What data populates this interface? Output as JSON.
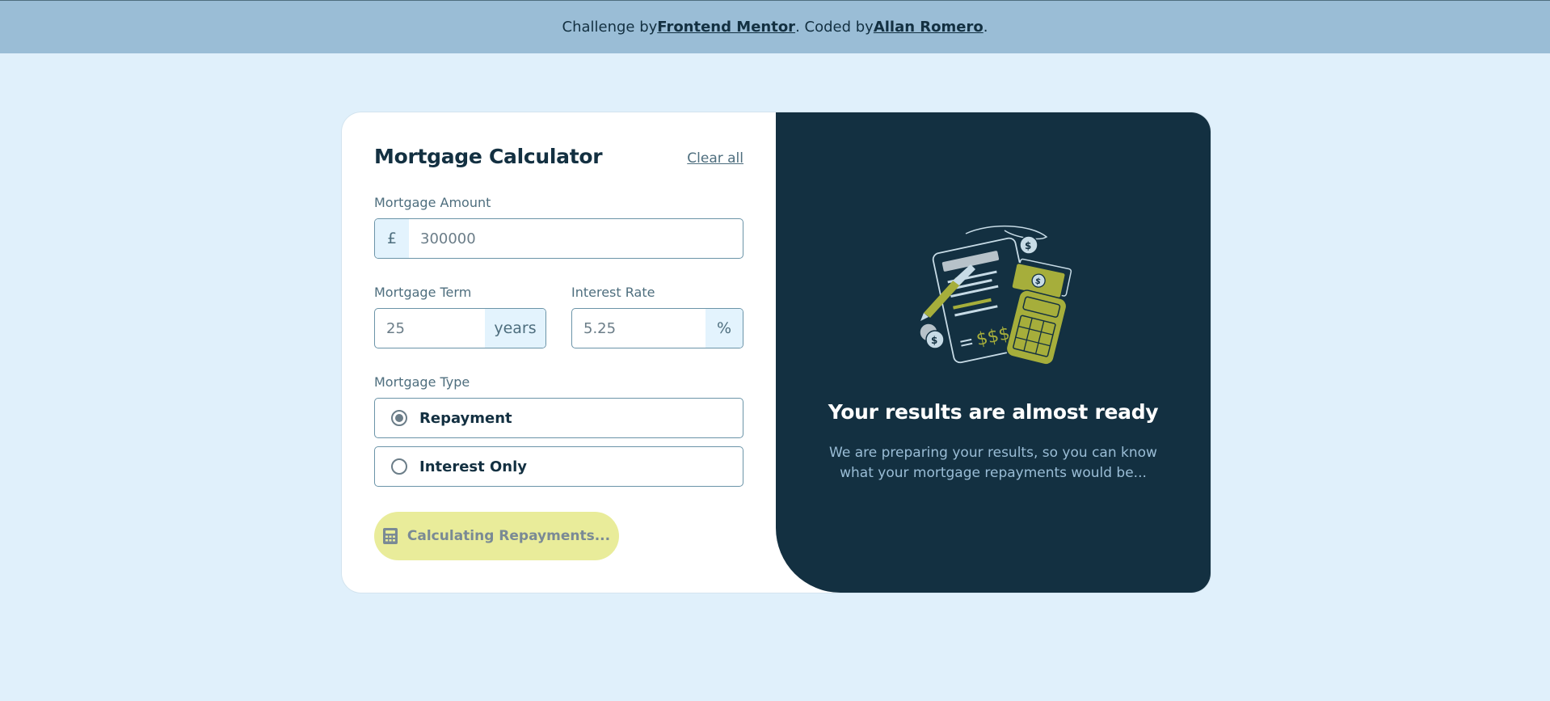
{
  "attribution": {
    "prefix": "Challenge by ",
    "challenge_link": "Frontend Mentor",
    "middle": ". Coded by ",
    "author_link": "Allan Romero",
    "suffix": "."
  },
  "form": {
    "title": "Mortgage Calculator",
    "clear_label": "Clear all",
    "amount": {
      "label": "Mortgage Amount",
      "prefix": "£",
      "placeholder": "300000",
      "value": ""
    },
    "term": {
      "label": "Mortgage Term",
      "suffix": "years",
      "placeholder": "25",
      "value": ""
    },
    "rate": {
      "label": "Interest Rate",
      "suffix": "%",
      "placeholder": "5.25",
      "value": ""
    },
    "type": {
      "label": "Mortgage Type",
      "options": [
        {
          "label": "Repayment",
          "selected": true
        },
        {
          "label": "Interest Only",
          "selected": false
        }
      ]
    },
    "submit_label": "Calculating Repayments..."
  },
  "results": {
    "title": "Your results are almost ready",
    "description": "We are preparing your results, so you can know what your mortgage repayments would be..."
  },
  "colors": {
    "page_bg": "#e0f0fb",
    "header_bg": "#9abdd6",
    "dark_panel": "#133041",
    "accent_lime": "#d8db2f",
    "button_disabled": "#e9ec9a"
  }
}
